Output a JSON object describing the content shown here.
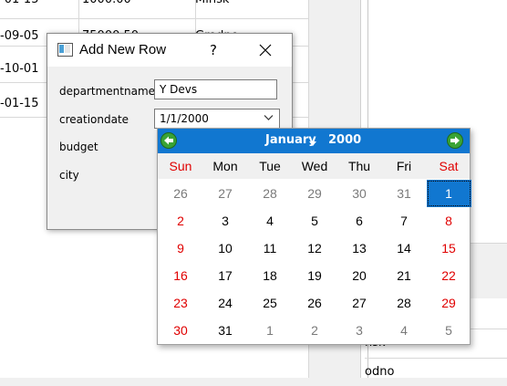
{
  "background_table": {
    "rows": [
      {
        "date": "-01-15",
        "budget": "1000.00",
        "city": "Minsk"
      },
      {
        "date": "-09-05",
        "budget": "75000.50",
        "city": "Grodno"
      },
      {
        "date": "-10-01",
        "budget": "",
        "city": ""
      },
      {
        "date": "-01-15",
        "budget": "",
        "city": ""
      }
    ],
    "right_cells": [
      "nsk",
      "odno"
    ]
  },
  "dialog": {
    "title": "Add New Row",
    "help_label": "?",
    "fields": [
      {
        "label": "departmentname",
        "value": "Y Devs"
      },
      {
        "label": "creationdate",
        "value": "1/1/2000"
      },
      {
        "label": "budget",
        "value": ""
      },
      {
        "label": "city",
        "value": ""
      }
    ]
  },
  "calendar": {
    "month": "January",
    "year": "2000",
    "weekdays": [
      "Sun",
      "Mon",
      "Tue",
      "Wed",
      "Thu",
      "Fri",
      "Sat"
    ],
    "weeks": [
      [
        "26",
        "27",
        "28",
        "29",
        "30",
        "31",
        "1"
      ],
      [
        "2",
        "3",
        "4",
        "5",
        "6",
        "7",
        "8"
      ],
      [
        "9",
        "10",
        "11",
        "12",
        "13",
        "14",
        "15"
      ],
      [
        "16",
        "17",
        "18",
        "19",
        "20",
        "21",
        "22"
      ],
      [
        "23",
        "24",
        "25",
        "26",
        "27",
        "28",
        "29"
      ],
      [
        "30",
        "31",
        "1",
        "2",
        "3",
        "4",
        "5"
      ]
    ],
    "selected": {
      "week": 0,
      "day": 6
    },
    "colors": {
      "header": "#1177d0",
      "weekend": "#e00000",
      "other_month": "#7a7a7a",
      "current_month": "#000000",
      "nav_button": "#3aa335"
    }
  }
}
